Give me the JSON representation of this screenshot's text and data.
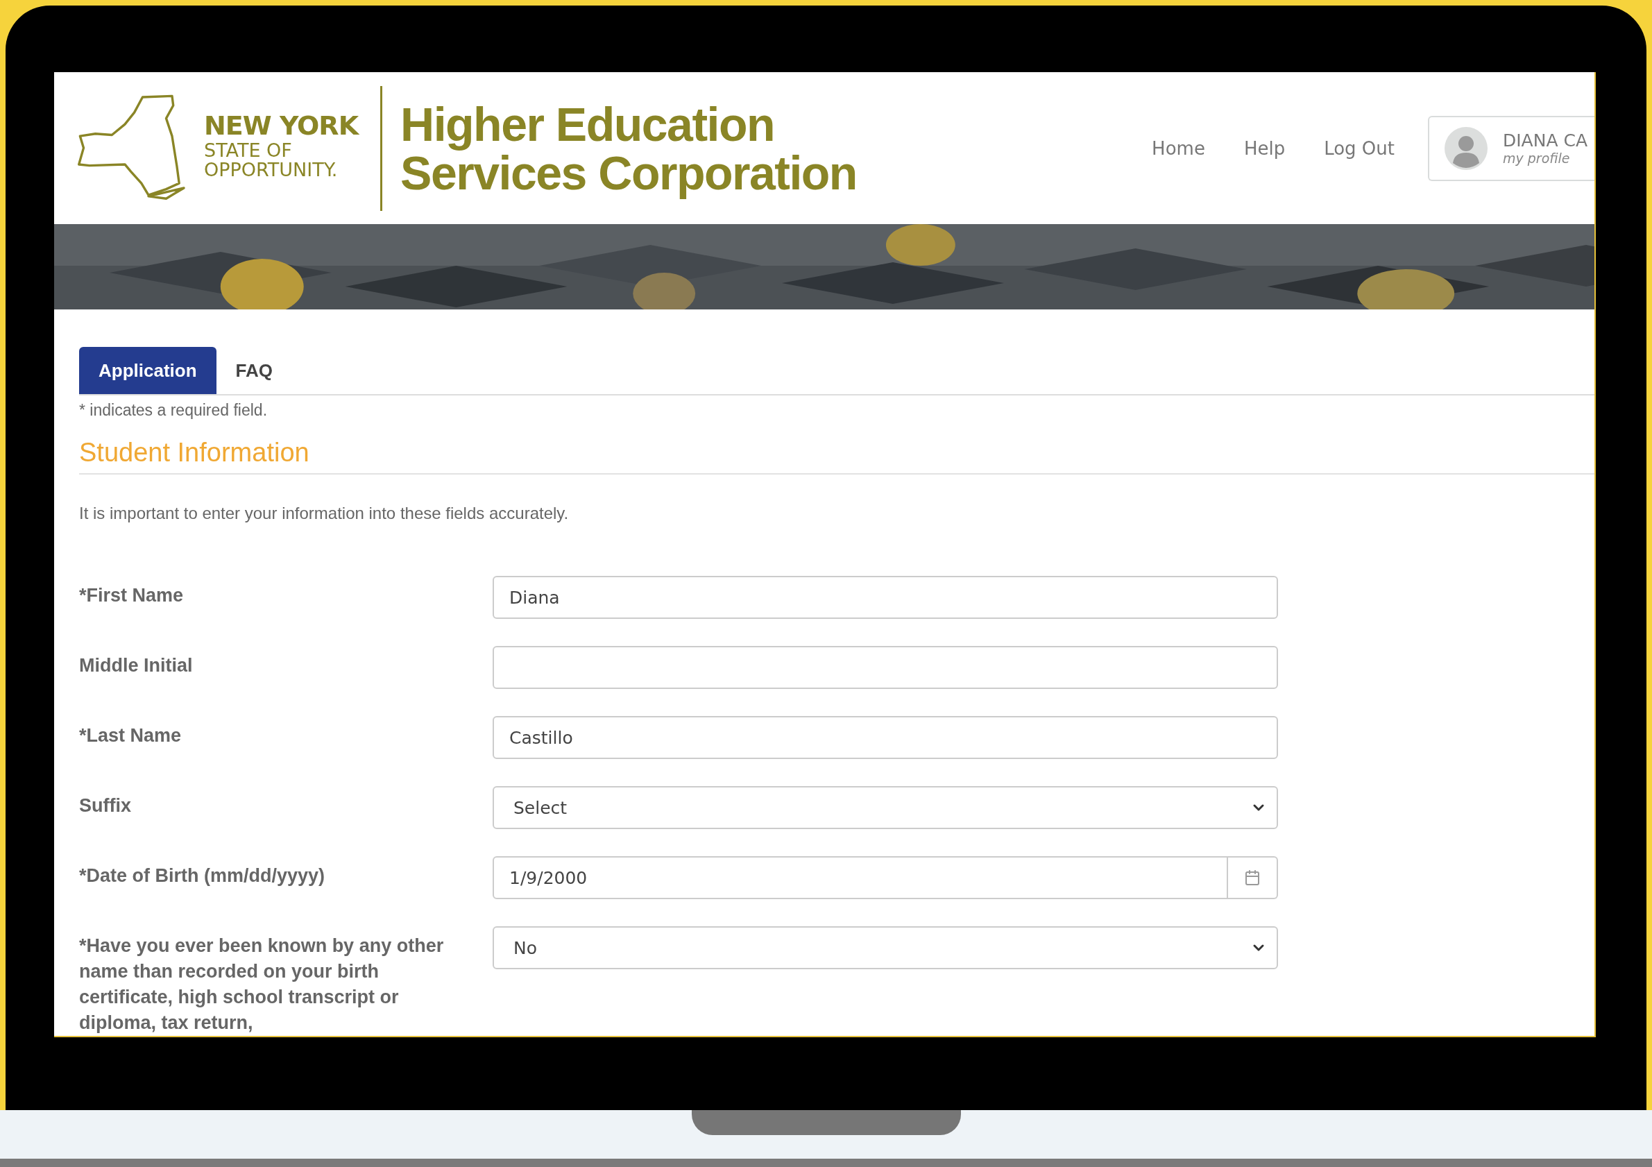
{
  "header": {
    "logo": {
      "lines": [
        "NEW YORK",
        "STATE OF",
        "OPPORTUNITY."
      ],
      "agency": [
        "Higher Education",
        "Services Corporation"
      ]
    },
    "nav": [
      "Home",
      "Help",
      "Log Out"
    ],
    "profile": {
      "name": "DIANA CA",
      "link": "my profile"
    }
  },
  "tabs": [
    {
      "label": "Application",
      "selected": true
    },
    {
      "label": "FAQ",
      "selected": false
    }
  ],
  "required_note": "* indicates a required field.",
  "section_title": "Student Information",
  "intro": "It is important to enter your information into these fields accurately.",
  "fields": [
    {
      "kind": "text",
      "label": "*First Name",
      "value": "Diana"
    },
    {
      "kind": "text",
      "label": "Middle Initial"
    },
    {
      "kind": "text",
      "label": "*Last Name",
      "value": "Castillo"
    },
    {
      "kind": "select",
      "label": "Suffix",
      "value": "Select"
    },
    {
      "kind": "date",
      "label": "*Date of Birth (mm/dd/yyyy)",
      "value": "1/9/2000"
    },
    {
      "kind": "select",
      "label": "*Have you ever been known by any other name than recorded on your birth certificate, high school transcript or diploma, tax return,",
      "value": "No"
    }
  ]
}
